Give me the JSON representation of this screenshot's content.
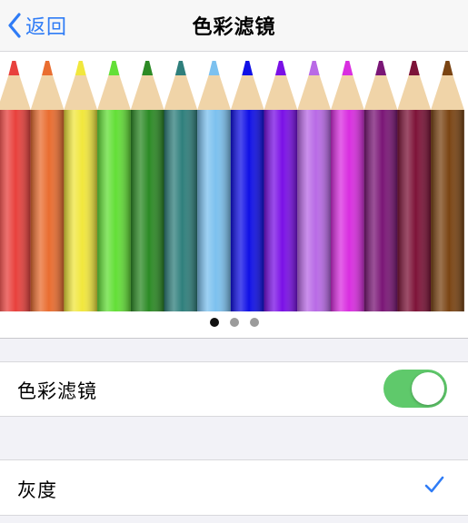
{
  "nav": {
    "back_label": "返回",
    "title": "色彩滤镜"
  },
  "preview": {
    "pencil_colors": [
      "#e8413d",
      "#e96d30",
      "#f1e73d",
      "#63df37",
      "#2c8a25",
      "#2f7f7c",
      "#7cc1ef",
      "#1010e6",
      "#7a10e6",
      "#b96ae6",
      "#d92ee0",
      "#7a1676",
      "#7d1338",
      "#7a4413"
    ],
    "page_count": 3,
    "active_page": 0
  },
  "filter_row": {
    "label": "色彩滤镜",
    "toggle_on": true,
    "toggle_color": "#5fc96b"
  },
  "options": [
    {
      "label": "灰度",
      "selected": true
    }
  ],
  "accent_color": "#2f7cf6"
}
